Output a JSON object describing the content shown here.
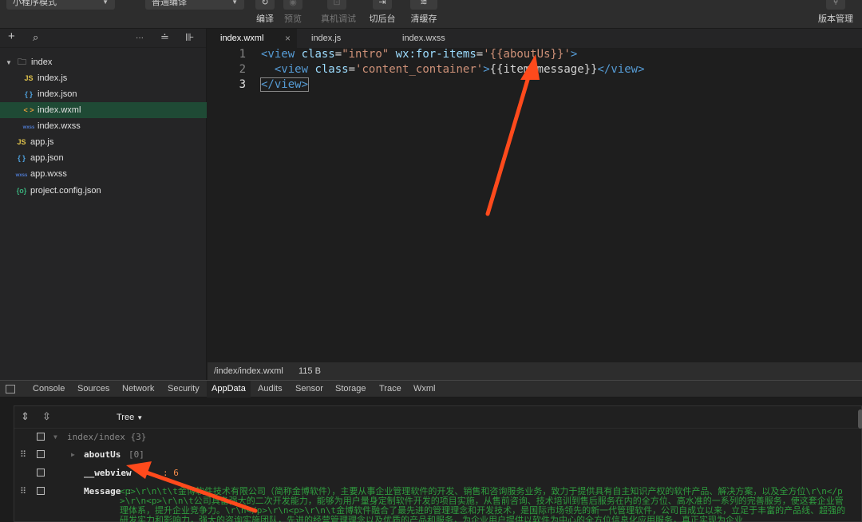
{
  "toolbar": {
    "mode_select": "小程序模式",
    "compile_select": "普通编译",
    "buttons": [
      {
        "icon": "↻",
        "label": "编译"
      },
      {
        "icon": "◉",
        "label": "预览"
      },
      {
        "icon": "⊡",
        "label": "真机调试"
      },
      {
        "icon": "⇥",
        "label": "切后台"
      },
      {
        "icon": "≋",
        "label": "清缓存"
      }
    ],
    "version_manage": "版本管理"
  },
  "sidebar": {
    "tools": {
      "add": "+",
      "search": "⌕",
      "more": "···",
      "sort": "≐",
      "collapse": "⊪"
    },
    "folder": "index",
    "items": [
      {
        "icon": "JS",
        "name": "index.js"
      },
      {
        "icon": "{ }",
        "name": "index.json"
      },
      {
        "icon": "< >",
        "name": "index.wxml"
      },
      {
        "icon": "wxss",
        "name": "index.wxss"
      },
      {
        "icon": "JS",
        "name": "app.js"
      },
      {
        "icon": "{ }",
        "name": "app.json"
      },
      {
        "icon": "wxss",
        "name": "app.wxss"
      },
      {
        "icon": "{o}",
        "name": "project.config.json"
      }
    ]
  },
  "editor": {
    "tabs": [
      "index.wxml",
      "index.js",
      "index.wxss"
    ],
    "close_glyph": "×",
    "line_numbers": [
      "1",
      "2",
      "3"
    ],
    "line1": {
      "open": "<view",
      "attr1": "class",
      "eq1": "=",
      "val1": "\"intro\"",
      "attr2": "wx:for-items",
      "eq2": "=",
      "val2": "'{{aboutUs}}'",
      "close": ">"
    },
    "line2": {
      "open": "<view",
      "attr": "class",
      "eq": "=",
      "val": "'content_container'",
      "gt": ">",
      "text": "{{item.message}}",
      "end": "</view>"
    },
    "line3": {
      "end": "</view>"
    }
  },
  "status": {
    "path": "/index/index.wxml",
    "size": "115 B"
  },
  "devtools": {
    "tabs": [
      "Console",
      "Sources",
      "Network",
      "Security",
      "AppData",
      "Audits",
      "Sensor",
      "Storage",
      "Trace",
      "Wxml"
    ],
    "active_tab": "AppData",
    "tree_mode": "Tree",
    "root": "index/index {3}",
    "rows": [
      {
        "key": "aboutUs",
        "meta": "[0]"
      },
      {
        "key": "__webview",
        "value": ": 6"
      },
      {
        "key": "Message",
        "value": ":"
      }
    ],
    "message_text": "<p>\\r\\n\\t\\t金博软件技术有限公司（简称金博软件），主要从事企业管理软件的开发、销售和咨询服务业务，致力于提供具有自主知识产权的软件产品、解决方案，以及全方位\\r\\n</p>\\r\\n<p>\\r\\n\\t公司具备强大的二次开发能力，能够为用户量身定制软件开发的项目实施，从售前咨询、技术培训到售后服务在内的全方位、高水准的一系列的完善服务，使这套企业管理体系，提升企业竞争力。\\r\\n</p>\\r\\n<p>\\r\\n\\t金博软件融合了最先进的管理理念和开发技术，是国际市场领先的新一代管理软件，公司自成立以来，立足于丰富的产品线、超强的研发实力和影响力，强大的咨询实施团队，先进的经营管理理念以及优质的产品和服务，为企业用户提供以软件为中心的全方位信息化应用服务，真正实现为企业"
  },
  "colors": {
    "accent_arrow": "#ff4a1c",
    "active_file": "#1f4a35"
  }
}
